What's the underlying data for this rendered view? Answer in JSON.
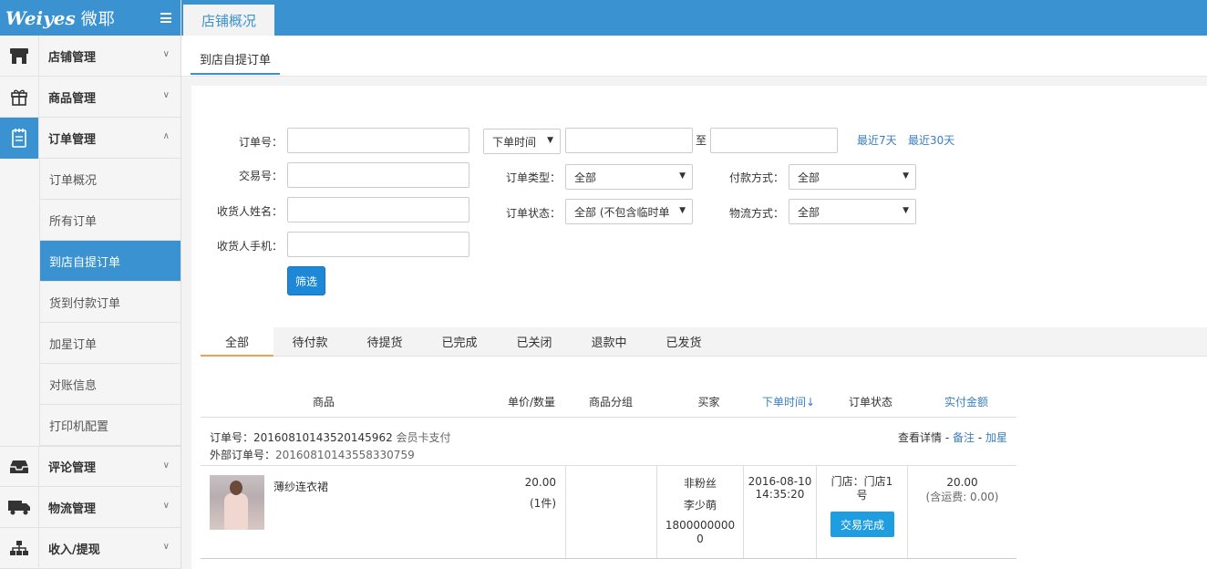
{
  "logo": {
    "brand": "Weiyes",
    "brand_cn": "微耶"
  },
  "sidebar": {
    "groups": [
      {
        "label": "店铺管理",
        "icon": "store-icon"
      },
      {
        "label": "商品管理",
        "icon": "gift-icon"
      },
      {
        "label": "订单管理",
        "icon": "notepad-icon"
      },
      {
        "label": "评论管理",
        "icon": "inbox-icon"
      },
      {
        "label": "物流管理",
        "icon": "truck-icon"
      },
      {
        "label": "收入/提现",
        "icon": "sitemap-icon"
      }
    ],
    "order_items": [
      "订单概况",
      "所有订单",
      "到店自提订单",
      "货到付款订单",
      "加星订单",
      "对账信息",
      "打印机配置"
    ]
  },
  "topbar": {
    "tab": "店铺概况"
  },
  "subheader": {
    "tab": "到店自提订单"
  },
  "filters": {
    "order_no_label": "订单号：",
    "trade_no_label": "交易号：",
    "receiver_name_label": "收货人姓名：",
    "receiver_phone_label": "收货人手机：",
    "time_select": "下单时间",
    "to": "至",
    "last7": "最近7天",
    "last30": "最近30天",
    "order_type_label": "订单类型：",
    "order_type_value": "全部",
    "order_status_label": "订单状态：",
    "order_status_value": "全部 (不包含临时单",
    "pay_method_label": "付款方式：",
    "pay_method_value": "全部",
    "logistics_label": "物流方式：",
    "logistics_value": "全部",
    "filter_button": "筛选"
  },
  "status_tabs": [
    "全部",
    "待付款",
    "待提货",
    "已完成",
    "已关闭",
    "退款中",
    "已发货"
  ],
  "table": {
    "headers": {
      "product": "商品",
      "price_qty": "单价/数量",
      "group": "商品分组",
      "buyer": "买家",
      "order_time": "下单时间↓",
      "status": "订单状态",
      "paid": "实付金额"
    },
    "order": {
      "order_no_label": "订单号：",
      "order_no": "20160810143520145962",
      "pay_type": "会员卡支付",
      "ext_no_label": "外部订单号：",
      "ext_no": "20160810143558330759",
      "view_detail": "查看详情",
      "sep": " - ",
      "note": "备注",
      "star": "加星",
      "product_name": "薄纱连衣裙",
      "price": "20.00",
      "qty": "(1件)",
      "buyer_line1": "非粉丝",
      "buyer_line2": "李少萌",
      "buyer_line3": "18000000000",
      "time_line1": "2016-08-10",
      "time_line2": "14:35:20",
      "store": "门店：门店1号",
      "status_button": "交易完成",
      "amount": "20.00",
      "shipping": "(含运费: 0.00)"
    }
  }
}
